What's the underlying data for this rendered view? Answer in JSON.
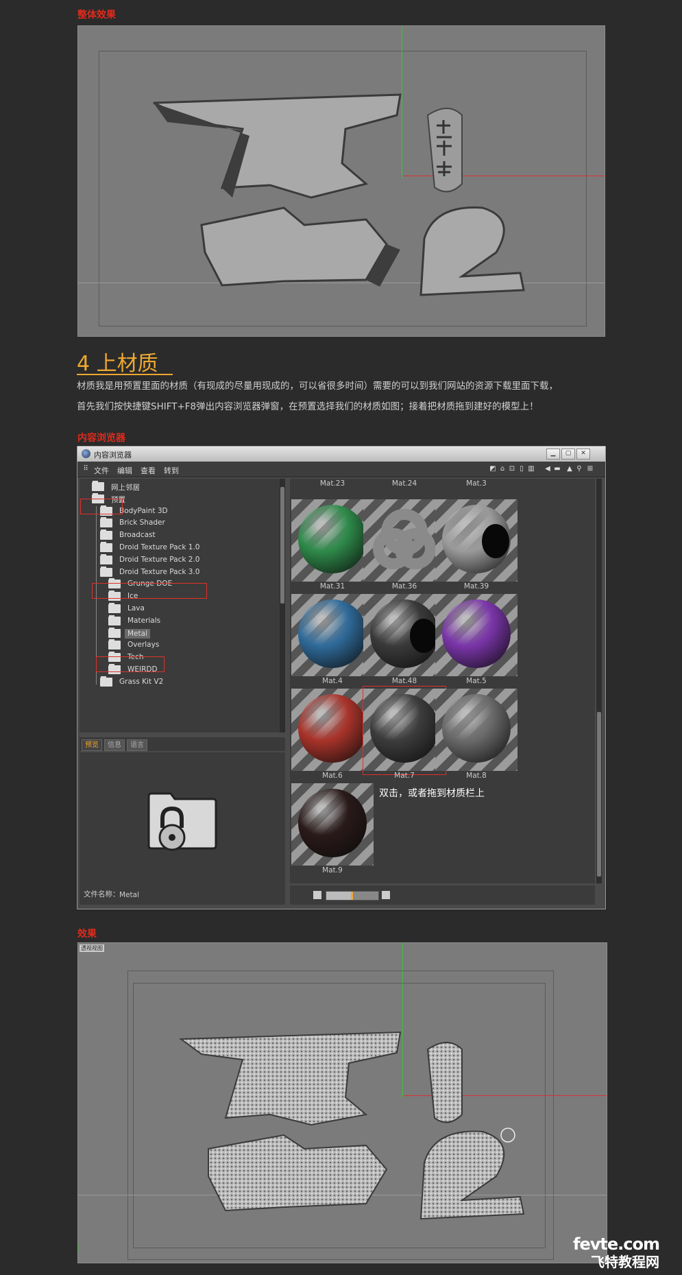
{
  "sections": {
    "overall_label": "整体效果",
    "browser_label": "内容浏览器",
    "effect_label": "效果"
  },
  "step": {
    "heading": "4 上材质",
    "line1": "材质我是用预置里面的材质（有现成的尽量用现成的，可以省很多时间）需要的可以到我们网站的资源下载里面下载，",
    "line2": "首先我们按快捷键SHIFT+F8弹出内容浏览器弹窗，在预置选择我们的材质如图；接着把材质拖到建好的模型上！"
  },
  "window": {
    "title": "内容浏览器",
    "menu": [
      "文件",
      "编辑",
      "查看",
      "转到"
    ],
    "tree": [
      {
        "label": "网上邻居",
        "level": 0
      },
      {
        "label": "预置",
        "level": 0
      },
      {
        "label": "BodyPaint 3D",
        "level": 1
      },
      {
        "label": "Brick Shader",
        "level": 1
      },
      {
        "label": "Broadcast",
        "level": 1
      },
      {
        "label": "Droid Texture Pack 1.0",
        "level": 1
      },
      {
        "label": "Droid Texture Pack 2.0",
        "level": 1
      },
      {
        "label": "Droid Texture Pack 3.0",
        "level": 1
      },
      {
        "label": "Grunge DOE",
        "level": 2
      },
      {
        "label": "Ice",
        "level": 2
      },
      {
        "label": "Lava",
        "level": 2
      },
      {
        "label": "Materials",
        "level": 2
      },
      {
        "label": "Metal",
        "level": 2,
        "selected": true
      },
      {
        "label": "Overlays",
        "level": 2
      },
      {
        "label": "Tech",
        "level": 2
      },
      {
        "label": "WEIRDD",
        "level": 2
      },
      {
        "label": "Grass Kit V2",
        "level": 1
      }
    ],
    "tabs": [
      "预览",
      "信息",
      "语言"
    ],
    "filename_label": "文件名称：",
    "filename_value": "Metal",
    "top_row": [
      "Mat.23",
      "Mat.24",
      "Mat.3"
    ],
    "materials": [
      {
        "name": "Mat.31",
        "kind": "sphere",
        "color": "#2e8a4a"
      },
      {
        "name": "Mat.36",
        "kind": "knot",
        "color": "#8a8a8a"
      },
      {
        "name": "Mat.39",
        "kind": "hollow",
        "color": "#9a9a9a"
      },
      {
        "name": "Mat.4",
        "kind": "sphere",
        "color": "#2f6a99"
      },
      {
        "name": "Mat.48",
        "kind": "hollow",
        "color": "#3a3a3a"
      },
      {
        "name": "Mat.5",
        "kind": "sphere",
        "color": "#7a35a8"
      },
      {
        "name": "Mat.6",
        "kind": "sphere",
        "color": "#a8332a"
      },
      {
        "name": "Mat.7",
        "kind": "sphere",
        "color": "#3c3c3c",
        "highlight": true
      },
      {
        "name": "Mat.8",
        "kind": "sphere",
        "color": "#6b6a6a"
      },
      {
        "name": "Mat.9",
        "kind": "sphere",
        "color": "#2a1a1a"
      }
    ],
    "annotation": "双击，或者拖到材质栏上"
  },
  "effect": {
    "viewport_tag": "透视视图"
  },
  "watermark": {
    "line1": "fevte.com",
    "line2": "飞特教程网"
  }
}
